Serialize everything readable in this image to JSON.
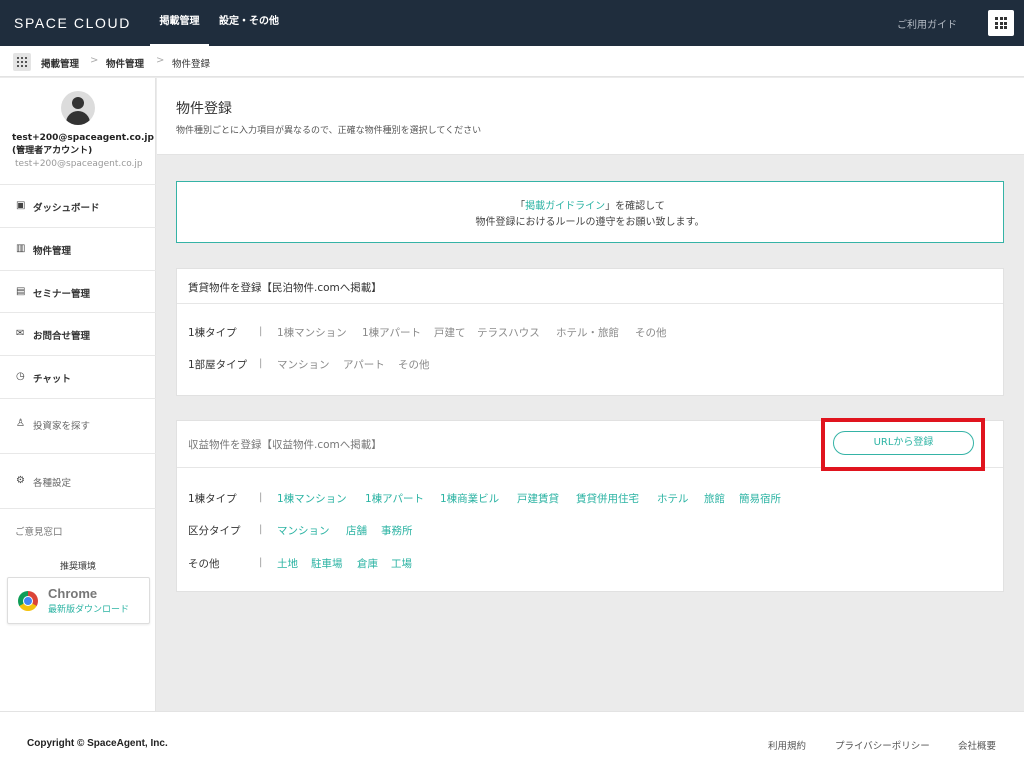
{
  "topbar": {
    "brand": "SPACE CLOUD",
    "tabs": [
      {
        "label": "掲載管理",
        "active": true
      },
      {
        "label": "設定・その他",
        "active": false
      }
    ],
    "guide": "ご利用ガイド",
    "apps_icon": "grid-icon"
  },
  "breadcrumb": [
    "掲載管理",
    "物件管理",
    "物件登録"
  ],
  "breadcrumb_separator": ">",
  "sidebar": {
    "user_email": "test+200@spaceagent.co.jp",
    "user_role": "(管理者アカウント)",
    "user_sub": "test+200@spaceagent.co.jp",
    "items": [
      {
        "label": "ダッシュボード",
        "icon": "▣"
      },
      {
        "label": "物件管理",
        "icon": "▥"
      },
      {
        "label": "セミナー管理",
        "icon": "▤"
      },
      {
        "label": "お問合せ管理",
        "icon": "✉"
      },
      {
        "label": "チャット",
        "icon": "◷"
      },
      {
        "label": "投資家を探す",
        "icon": "♙"
      },
      {
        "label": "各種設定",
        "icon": "⚙"
      }
    ],
    "feedback": "ご意見窓口",
    "env_label": "推奨環境",
    "chrome": {
      "name": "Chrome",
      "download": "最新版ダウンロード"
    }
  },
  "page": {
    "title": "物件登録",
    "description": "物件種別ごとに入力項目が異なるので、正確な物件種別を選択してください"
  },
  "guideline": {
    "open_quote": "「",
    "link": "掲載ガイドライン",
    "close_quote": "」を確認して",
    "line2": "物件登録におけるルールの遵守をお願い致します。"
  },
  "rental_card": {
    "title": "賃貸物件を登録【民泊物件.comへ掲載】",
    "rows": [
      {
        "label": "1棟タイプ",
        "items": [
          "1棟マンション",
          "1棟アパート",
          "戸建て",
          "テラスハウス",
          "ホテル・旅館",
          "その他"
        ]
      },
      {
        "label": "1部屋タイプ",
        "items": [
          "マンション",
          "アパート",
          "その他"
        ]
      }
    ]
  },
  "income_card": {
    "title": "収益物件を登録【収益物件.comへ掲載】",
    "url_button": "URLから登録",
    "rows": [
      {
        "label": "1棟タイプ",
        "items": [
          "1棟マンション",
          "1棟アパート",
          "1棟商業ビル",
          "戸建賃貸",
          "賃貸併用住宅",
          "ホテル",
          "旅館",
          "簡易宿所"
        ]
      },
      {
        "label": "区分タイプ",
        "items": [
          "マンション",
          "店舗",
          "事務所"
        ]
      },
      {
        "label": "その他",
        "items": [
          "土地",
          "駐車場",
          "倉庫",
          "工場"
        ]
      }
    ]
  },
  "row_separator": "|",
  "footer": {
    "copyright": "Copyright © SpaceAgent, Inc.",
    "links": [
      "利用規約",
      "プライバシーポリシー",
      "会社概要"
    ]
  },
  "colors": {
    "topbar": "#1f2d3d",
    "accent": "#2bb3a3",
    "highlight": "#e0141e",
    "background": "#ebebeb"
  }
}
